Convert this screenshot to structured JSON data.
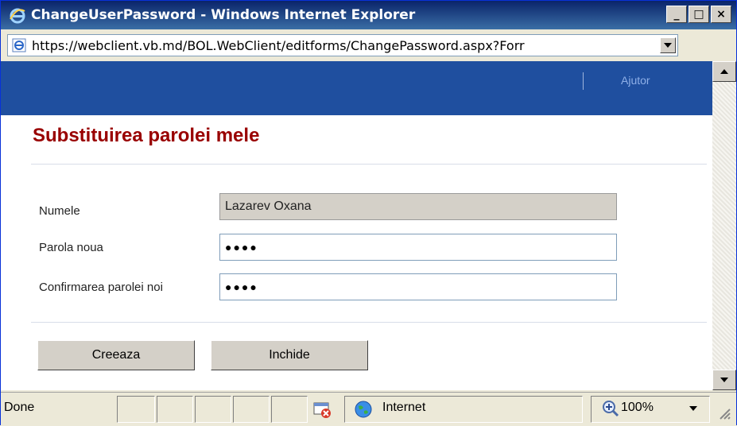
{
  "window": {
    "title": "ChangeUserPassword - Windows Internet Explorer",
    "minimize": "_",
    "maximize": "□",
    "close": "×"
  },
  "address": {
    "url": "https://webclient.vb.md/BOL.WebClient/editforms/ChangePassword.aspx?Forr"
  },
  "nav": {
    "help_link": "Ajutor"
  },
  "page": {
    "title": "Substituirea parolei mele"
  },
  "form": {
    "name_label": "Numele",
    "name_value": "Lazarev Oxana",
    "new_password_label": "Parola noua",
    "new_password_value": "●●●●",
    "confirm_password_label": "Confirmarea parolei noi",
    "confirm_password_value": "●●●●"
  },
  "buttons": {
    "create": "Creeaza",
    "close": "Inchide"
  },
  "status": {
    "text": "Done",
    "zone": "Internet",
    "zoom": "100%"
  },
  "colors": {
    "titlebar": "#0a246a",
    "nav": "#1f4f9f",
    "page_title": "#990000"
  }
}
